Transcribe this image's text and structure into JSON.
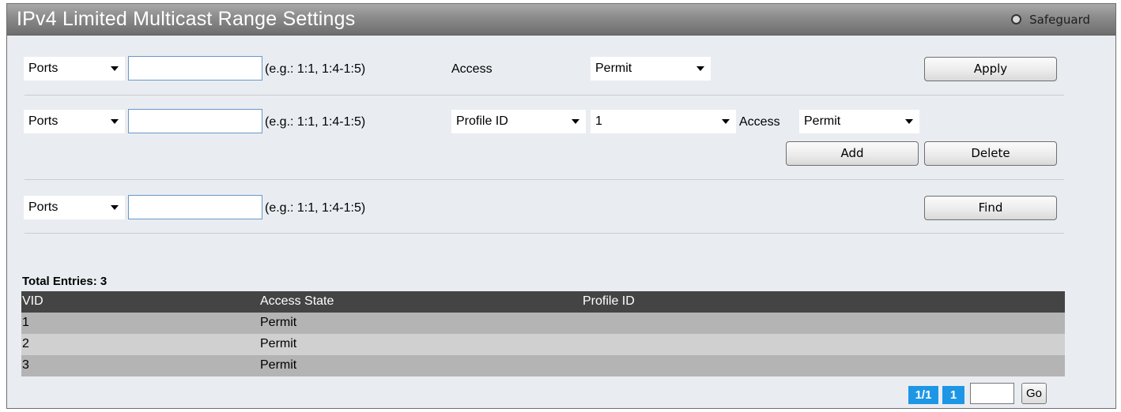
{
  "header": {
    "title": "IPv4 Limited Multicast Range Settings",
    "safeguard": "Safeguard"
  },
  "row1": {
    "type_select": "Ports",
    "port_value": "",
    "hint": "(e.g.: 1:1, 1:4-1:5)",
    "access_label": "Access",
    "access_select": "Permit",
    "apply_label": "Apply"
  },
  "row2": {
    "type_select": "Ports",
    "port_value": "",
    "hint": "(e.g.: 1:1, 1:4-1:5)",
    "profile_select": "Profile ID",
    "profile_value_select": "1",
    "access_label": "Access",
    "access_select": "Permit",
    "add_label": "Add",
    "delete_label": "Delete"
  },
  "row3": {
    "type_select": "Ports",
    "port_value": "",
    "hint": "(e.g.: 1:1, 1:4-1:5)",
    "find_label": "Find"
  },
  "table": {
    "total": "Total Entries: 3",
    "columns": [
      "VID",
      "Access State",
      "Profile ID"
    ],
    "rows": [
      [
        "1",
        "Permit",
        ""
      ],
      [
        "2",
        "Permit",
        ""
      ],
      [
        "3",
        "Permit",
        ""
      ]
    ]
  },
  "pager": {
    "page_of": "1/1",
    "page": "1",
    "go_value": "",
    "go_label": "Go"
  },
  "colors": {
    "row_odd": "#b4b4b4",
    "row_even": "#d0d0d0",
    "header_bg": "#444444",
    "pager_blue": "#1e96e6"
  }
}
